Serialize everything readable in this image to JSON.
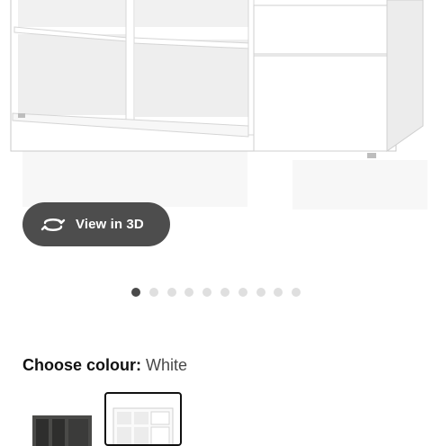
{
  "product_image": {
    "alt_icon": "tv-bench-image"
  },
  "view3d": {
    "label": "View in 3D",
    "icon": "rotate-3d-icon"
  },
  "carousel": {
    "count": 10,
    "active_index": 0
  },
  "colour": {
    "label": "Choose colour:",
    "value": "White"
  },
  "swatches": [
    {
      "colour": "Dark grey",
      "selected": false
    },
    {
      "colour": "White",
      "selected": true
    }
  ]
}
